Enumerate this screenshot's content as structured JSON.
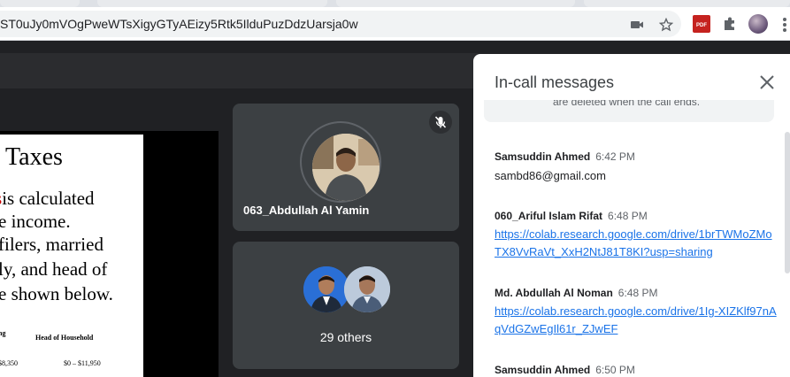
{
  "browser": {
    "url": "ST0uJy0mVOgPweWTsXigyGTyAEizy5Rtk5IlduPuzDdzUarsja0w",
    "pdf_extension_label": "PDF"
  },
  "slide": {
    "title": "Taxes",
    "lines": [
      "is calculated",
      "e income.",
      "filers, married",
      "ly, and head of",
      "e shown below."
    ],
    "mark": "s",
    "col_left_label": "ng",
    "col_right_label": "Head of Household",
    "row_left": "$8,350",
    "row_right": "$0 – $11,950"
  },
  "participants": {
    "main_tile": {
      "name": "063_Abdullah Al Yamin",
      "mic_state": "muted"
    },
    "others_tile": {
      "label": "29 others"
    }
  },
  "chat": {
    "title": "In-call messages",
    "notice": "are deleted when the call ends.",
    "messages": [
      {
        "sender": "Samsuddin Ahmed",
        "time": "6:42 PM",
        "text": "sambd86@gmail.com"
      },
      {
        "sender": "060_Ariful Islam Rifat",
        "time": "6:48 PM",
        "link": "https://colab.research.google.com/drive/1brTWMoZMoTX8VvRaVt_XxH2NtJ81T8KI?usp=sharing"
      },
      {
        "sender": "Md. Abdullah Al Noman",
        "time": "6:48 PM",
        "link": "https://colab.research.google.com/drive/1Ig-XIZKlf97nAqVdGZwEgIl61r_ZJwEF"
      },
      {
        "sender": "Samsuddin Ahmed",
        "time": "6:50 PM"
      }
    ]
  },
  "colors": {
    "stage_bg": "#202124",
    "tile_bg": "#3c4043",
    "link": "#1a73e8",
    "panel_bg": "#ffffff"
  }
}
